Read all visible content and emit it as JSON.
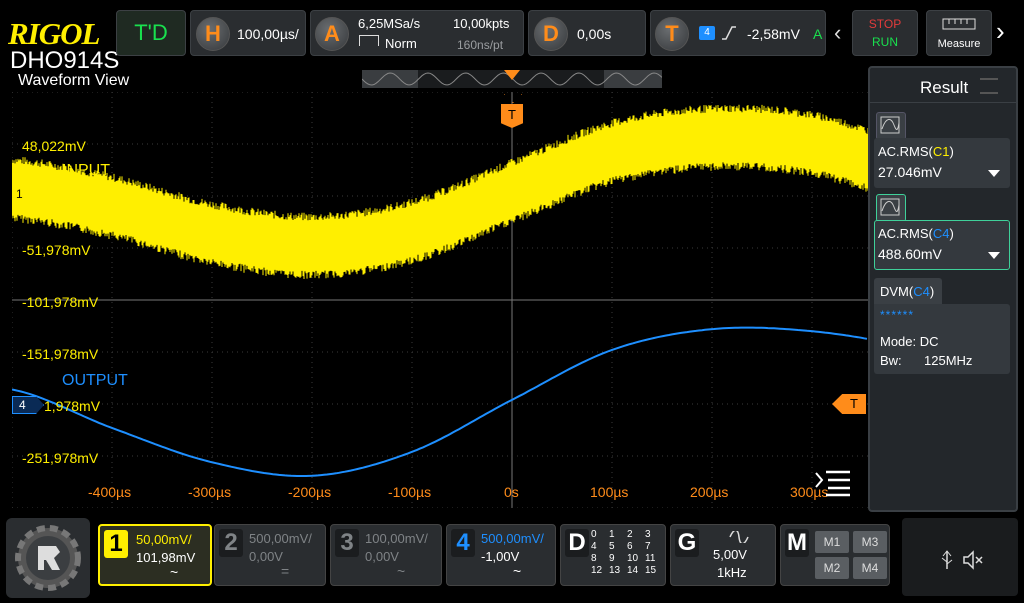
{
  "brand": {
    "logo": "RIGOL",
    "model": "DHO914S"
  },
  "header": {
    "mode": "T'D",
    "horizontal": {
      "key": "H",
      "scale": "100,00µs/"
    },
    "acquire": {
      "key": "A",
      "sample_rate": "6,25MSa/s",
      "mode": "Norm",
      "points": "10,00kpts",
      "interval": "160ns/pt"
    },
    "delay": {
      "key": "D",
      "value": "0,00s"
    },
    "trigger": {
      "key": "T",
      "source": "4",
      "level": "-2,58mV",
      "sweep": "A"
    },
    "run_stop": {
      "stop": "STOP",
      "run": "RUN"
    },
    "measure_label": "Measure"
  },
  "waveform": {
    "title": "Waveform View",
    "trigger_marker": "T",
    "y_labels": [
      "48,022mV",
      "-51,978mV",
      "-101,978mV",
      "-151,978mV",
      "1,978mV",
      "-251,978mV"
    ],
    "x_labels": [
      "-400µs",
      "-300µs",
      "-200µs",
      "-100µs",
      "0s",
      "100µs",
      "200µs",
      "300µs",
      "400µs"
    ],
    "channel1": {
      "label": "INPUT",
      "marker": "1",
      "color": "#ffef00"
    },
    "channel4": {
      "label": "OUTPUT",
      "marker": "4",
      "color": "#1e8fff"
    },
    "trigger_level_marker": "T"
  },
  "result": {
    "title": "Result",
    "items": [
      {
        "name": "AC.RMS(",
        "ch": "C1",
        "close": ")",
        "value": "27.046mV",
        "ch_color": "#ffef00"
      },
      {
        "name": "AC.RMS(",
        "ch": "C4",
        "close": ")",
        "value": "488.60mV",
        "ch_color": "#1e8fff"
      }
    ],
    "dvm": {
      "name": "DVM(",
      "ch": "C4",
      "close": ")",
      "stars": "******",
      "mode": "Mode: DC",
      "bw_label": "Bw:",
      "bw_value": "125MHz"
    }
  },
  "channels": [
    {
      "num": "1",
      "scale": "50,00mV/",
      "offset": "101,98mV",
      "coupling": "~",
      "color": "#ffef00",
      "active": true
    },
    {
      "num": "2",
      "scale": "500,00mV/",
      "offset": "0,00V",
      "coupling": "=",
      "color": "#7f8386",
      "active": false
    },
    {
      "num": "3",
      "scale": "100,00mV/",
      "offset": "0,00V",
      "coupling": "~",
      "color": "#7f8386",
      "active": false
    },
    {
      "num": "4",
      "scale": "500,00mV/",
      "offset": "-1,00V",
      "coupling": "~",
      "color": "#1e8fff",
      "active": true
    }
  ],
  "digital": {
    "key": "D",
    "grid": [
      "0",
      "1",
      "2",
      "3",
      "4",
      "5",
      "6",
      "7",
      "8",
      "9",
      "10",
      "11",
      "12",
      "13",
      "14",
      "15"
    ]
  },
  "generator": {
    "key": "G",
    "amplitude": "5,00V",
    "frequency": "1kHz"
  },
  "math": {
    "key": "M",
    "buttons": [
      "M1",
      "M3",
      "M2",
      "M4"
    ]
  },
  "chart_data": {
    "type": "line",
    "x": [
      -500,
      -400,
      -300,
      -200,
      -100,
      0,
      100,
      200,
      300,
      400,
      500
    ],
    "xlabel": "",
    "ylabel": "",
    "series": [
      {
        "name": "INPUT",
        "unit": "mV",
        "values": [
          5,
          -12,
          -38,
          -50,
          -36,
          2,
          40,
          54,
          48,
          20,
          0
        ]
      },
      {
        "name": "OUTPUT",
        "unit": "mV",
        "values": [
          -188,
          -225,
          -258,
          -271,
          -248,
          -198,
          -150,
          -130,
          -132,
          -148,
          -175
        ]
      }
    ],
    "grid": true
  }
}
